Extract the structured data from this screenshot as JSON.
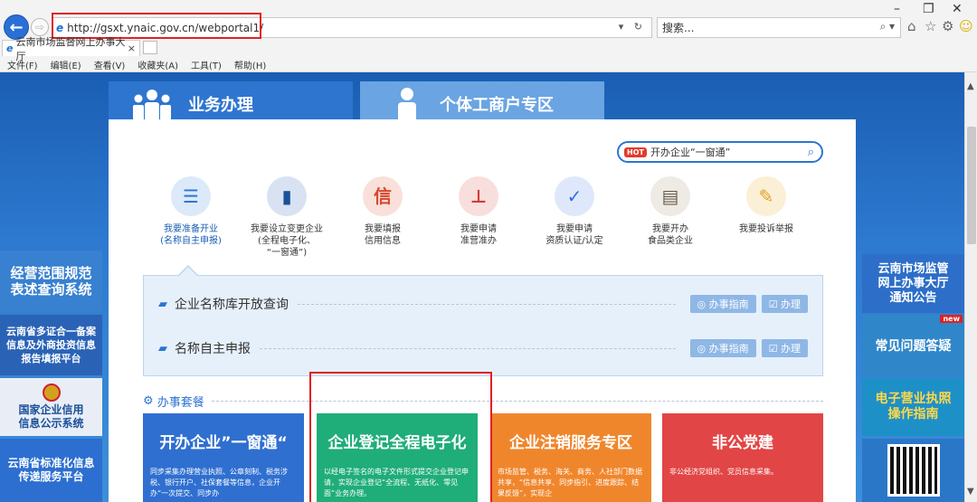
{
  "browser": {
    "url": "http://gsxt.ynaic.gov.cn/webportal1/",
    "search_placeholder": "搜索...",
    "tab_title": "云南市场监督网上办事大厅",
    "tab_close": "×",
    "menu": [
      "文件(F)",
      "编辑(E)",
      "查看(V)",
      "收藏夹(A)",
      "工具(T)",
      "帮助(H)"
    ],
    "addr_tools": "▾ ↻",
    "search_tools": "⌕ ▾",
    "win_min": "–",
    "win_restore": "❐",
    "win_close": "✕"
  },
  "tabs": {
    "business": "业务办理",
    "individual": "个体工商户专区"
  },
  "hot_search": {
    "badge": "HOT",
    "text": "开办企业“一窗通”"
  },
  "services": [
    {
      "label": "我要准备开业\n(名称自主申报)",
      "icon": "document-gear-icon",
      "glyph": "☰",
      "color": "#dce9f8",
      "fg": "#2e75d0"
    },
    {
      "label": "我要设立变更企业\n(全程电子化、\n“一窗通”)",
      "icon": "door-icon",
      "glyph": "▮",
      "color": "#d8e2f2",
      "fg": "#1a4f9a"
    },
    {
      "label": "我要填报\n信用信息",
      "icon": "credit-icon",
      "glyph": "信",
      "color": "#f9e0da",
      "fg": "#d9462c"
    },
    {
      "label": "我要申请\n准营准办",
      "icon": "stamp-icon",
      "glyph": "⊥",
      "color": "#f8dedd",
      "fg": "#d33a3a"
    },
    {
      "label": "我要申请\n资质认证/认定",
      "icon": "shield-icon",
      "glyph": "✓",
      "color": "#dfe8fa",
      "fg": "#2e6fe0"
    },
    {
      "label": "我要开办\n食品类企业",
      "icon": "food-bag-icon",
      "glyph": "▤",
      "color": "#eeeae4",
      "fg": "#6b5d4c"
    },
    {
      "label": "我要投诉举报",
      "icon": "complaint-icon",
      "glyph": "✎",
      "color": "#fbefd6",
      "fg": "#e0a020"
    }
  ],
  "sub_items": [
    {
      "label": "企业名称库开放查询",
      "guide": "办事指南",
      "do": "办理"
    },
    {
      "label": "名称自主申报",
      "guide": "办事指南",
      "do": "办理"
    }
  ],
  "packages_title": "办事套餐",
  "cards": [
    {
      "title": "开办企业”一窗通“",
      "desc": "同步采集办理营业执照、公章刻制、税务涉税、银行开户、社保套餐等信息，企业开办“一次提交、同步办"
    },
    {
      "title": "企业登记全程电子化",
      "desc": "以经电子签名的电子文件形式提交企业登记申请，实现企业登记“全流程、无纸化、零见面”业务办理。"
    },
    {
      "title": "企业注销服务专区",
      "desc": "市场监管、税务、海关、商务、人社部门数据共享，“信息共享、同步指引、进度跟踪、结果反馈”，实现企"
    },
    {
      "title": "非公党建",
      "desc": "非公经济党组织、党员信息采集。"
    }
  ],
  "left_banners": [
    "经营范围规范\n表述查询系统",
    "云南省多证合一备案\n信息及外商投资信息\n报告填报平台",
    "国家企业信用\n信息公示系统",
    "云南省标准化信息\n传递服务平台"
  ],
  "right_banners": {
    "notice": "云南市场监管\n网上办事大厅\n通知公告",
    "faq": "常见问题答疑",
    "new_badge": "new",
    "license": "电子营业执照\n操作指南"
  },
  "colors": {
    "accent": "#2e75d0",
    "highlight_box": "#e02020",
    "page_bg": "#2d7ad0"
  }
}
